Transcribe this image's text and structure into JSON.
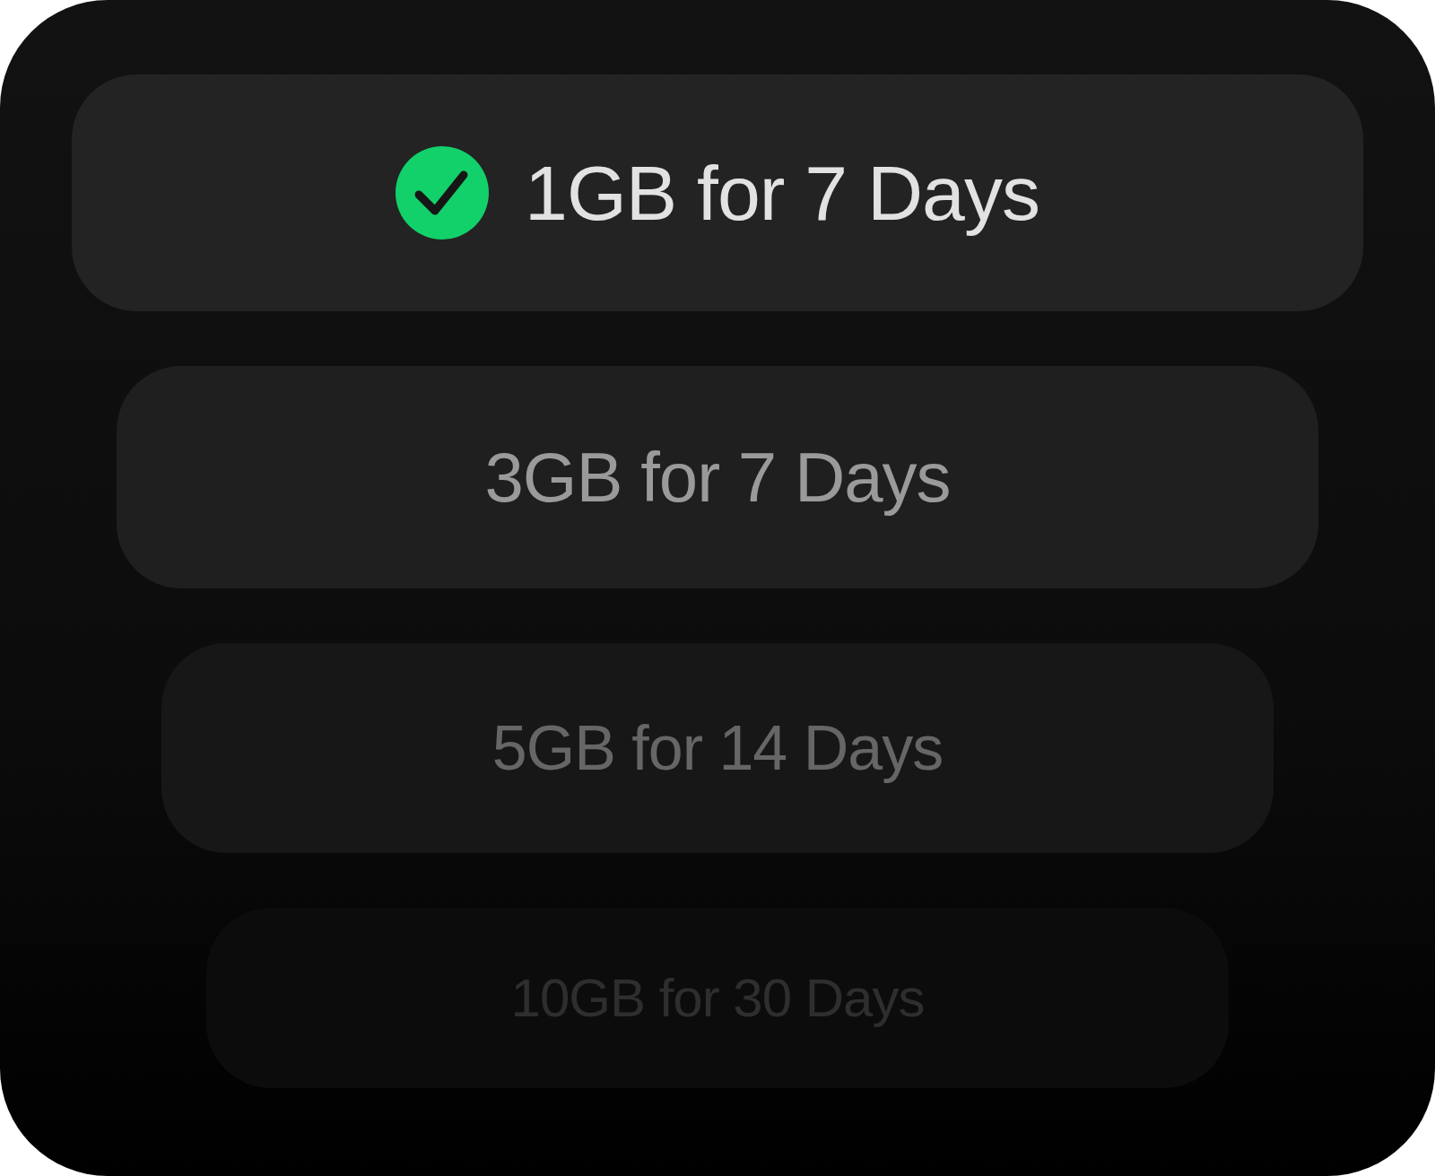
{
  "options": [
    {
      "label": "1GB for 7 Days",
      "selected": true
    },
    {
      "label": "3GB for 7 Days",
      "selected": false
    },
    {
      "label": "5GB for 14 Days",
      "selected": false
    },
    {
      "label": "10GB for 30 Days",
      "selected": false
    }
  ]
}
